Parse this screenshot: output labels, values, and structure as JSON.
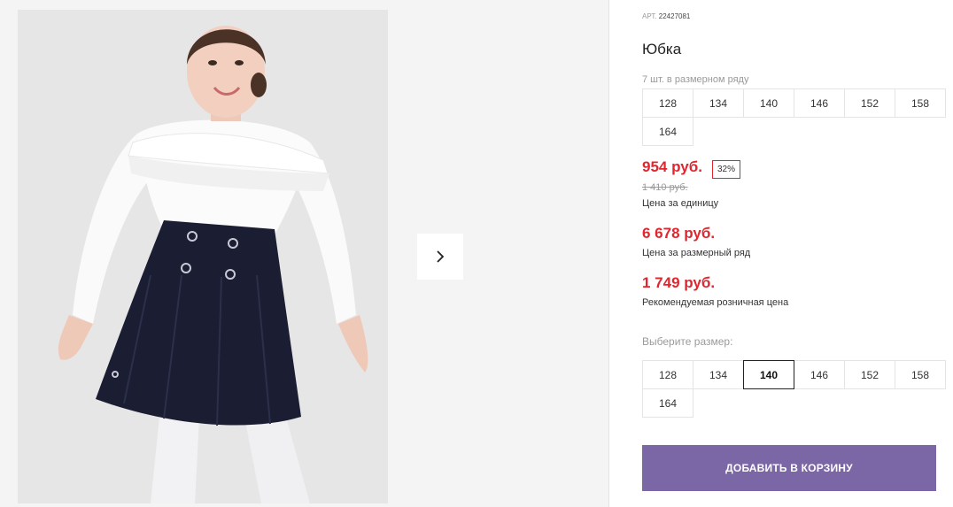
{
  "product": {
    "article_label": "АРТ.",
    "article_number": "22427081",
    "title": "Юбка",
    "row_note": "7 шт. в размерном ряду",
    "row_sizes": [
      "128",
      "134",
      "140",
      "146",
      "152",
      "158",
      "164"
    ]
  },
  "pricing": {
    "unit_price": "954 руб.",
    "discount": "32%",
    "old_price": "1 410 руб.",
    "unit_caption": "Цена за единицу",
    "row_price": "6 678 руб.",
    "row_caption": "Цена за размерный ряд",
    "retail_price": "1 749 руб.",
    "retail_caption": "Рекомендуемая розничная цена"
  },
  "size_select": {
    "label": "Выберите размер:",
    "sizes": [
      "128",
      "134",
      "140",
      "146",
      "152",
      "158",
      "164"
    ],
    "selected": "140"
  },
  "cart": {
    "add_label": "ДОБАВИТЬ В КОРЗИНУ"
  },
  "gallery": {
    "next_icon": "chevron-right-icon"
  },
  "colors": {
    "price_red": "#e0262f",
    "button_purple": "#7b66a6",
    "border": "#e4e4e4",
    "muted_text": "#9a9a9a"
  }
}
